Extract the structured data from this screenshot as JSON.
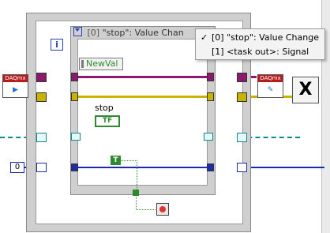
{
  "event_structure": {
    "iteration_label": "i",
    "header_prefix": "[0]",
    "header_text": "\"stop\": Value Chan",
    "newval_label": "NewVal",
    "stop_label": "stop",
    "stop_terminal_label": "TF"
  },
  "constants": {
    "zero_value": "0",
    "true_label": "T"
  },
  "daq_nodes": {
    "start_label": "DAQmx",
    "stop_label": "DAQmx"
  },
  "clear_icon_label": "X",
  "event_menu": {
    "items": [
      {
        "label": "[0] \"stop\": Value Change",
        "checked": true
      },
      {
        "label": "[1] <task out>: Signal",
        "checked": false
      }
    ]
  },
  "colors": {
    "task_wire": "#8b1a6f",
    "error_wire": "#c8b400",
    "event_wire": "#0a8a8a",
    "numeric_wire": "#1b2bb0",
    "boolean_wire": "#2f8a2f"
  }
}
